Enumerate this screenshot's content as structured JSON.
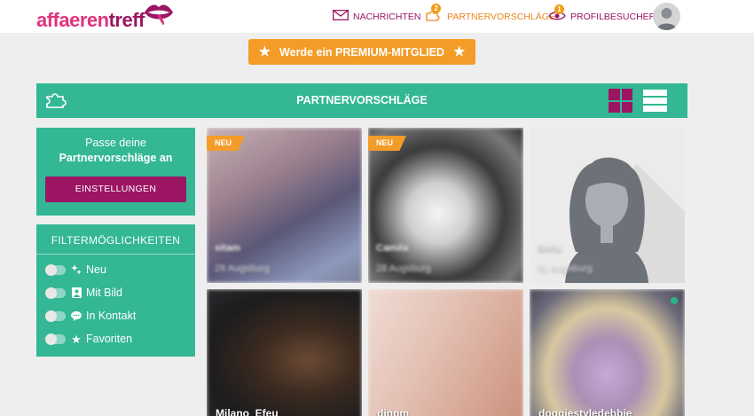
{
  "header": {
    "logo_prefix": "affaeren",
    "logo_suffix": "treff",
    "nav": [
      {
        "label": "NACHRICHTEN",
        "icon": "envelope-icon",
        "badge": ""
      },
      {
        "label": "PARTNERVORSCHLÄGE",
        "icon": "puzzle-icon",
        "badge": "2"
      },
      {
        "label": "PROFILBESUCHER",
        "icon": "eye-icon",
        "badge": "1"
      }
    ]
  },
  "premium": {
    "label": "Werde ein PREMIUM-MITGLIED"
  },
  "section": {
    "title": "PARTNERVORSCHLÄGE"
  },
  "settings_panel": {
    "line1": "Passe deine",
    "line2": "Partnervorschläge an",
    "button": "EINSTELLUNGEN"
  },
  "filter_panel": {
    "title": "FILTERMÖGLICHKEITEN",
    "filters": [
      {
        "label": "Neu",
        "icon": "sparkle-icon"
      },
      {
        "label": "Mit Bild",
        "icon": "portrait-icon"
      },
      {
        "label": "In Kontakt",
        "icon": "chat-icon"
      },
      {
        "label": "Favoriten",
        "icon": "star-icon"
      }
    ]
  },
  "cards": [
    {
      "name": "sitam",
      "age": "28 Augsburg",
      "badge": "NEU"
    },
    {
      "name": "Camila",
      "age": "28 Augsburg",
      "badge": "NEU"
    },
    {
      "name": "Sofia",
      "age": "31 Augsburg",
      "badge": ""
    },
    {
      "name": "Milano_Efeu",
      "age": "",
      "badge": ""
    },
    {
      "name": "dinpm",
      "age": "",
      "badge": ""
    },
    {
      "name": "doggiestyledebbie",
      "age": "",
      "badge": "",
      "online": true
    }
  ],
  "colors": {
    "brand_green": "#33b794",
    "brand_purple": "#9b1562",
    "accent_orange": "#f39c28",
    "logo_pink": "#e0337e"
  }
}
